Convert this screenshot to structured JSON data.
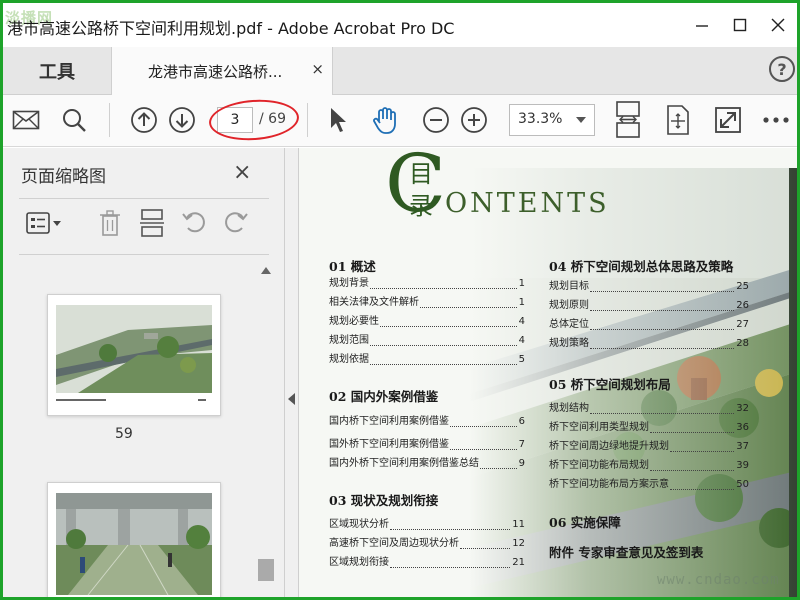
{
  "app": {
    "logo_text": "淡播网",
    "window_title": "港市高速公路桥下空间利用规划.pdf - Adobe Acrobat Pro DC",
    "window_controls": [
      "minimize-icon",
      "maximize-icon",
      "close-icon"
    ],
    "frame_color": "#1ea32a"
  },
  "tabs": {
    "tools_label": "工具",
    "doc_label": "龙港市高速公路桥...",
    "doc_close": "×",
    "help": "?"
  },
  "toolbar": {
    "icons": [
      "mail-icon",
      "search-icon",
      "page-up-icon",
      "page-down-icon",
      "select-arrow-icon",
      "hand-tool-icon",
      "zoom-out-icon",
      "zoom-in-icon",
      "fit-width-icon",
      "fit-page-icon",
      "fullscreen-icon",
      "more-icon"
    ],
    "current_page": "3",
    "total_pages": "/ 69",
    "zoom": "33.3%",
    "highlight_color": "#e0242a"
  },
  "thumbnails_panel": {
    "title": "页面缩略图",
    "close": "×",
    "tool_icons": [
      "options-menu-icon",
      "trash-icon",
      "insert-page-icon",
      "undo-icon",
      "redo-icon"
    ],
    "pages": [
      {
        "number": "59"
      },
      {
        "number": ""
      }
    ]
  },
  "document": {
    "heading_cn_1": "目",
    "heading_cn_2": "录",
    "heading_c": "C",
    "heading_en": "ONTENTS",
    "left_column": [
      {
        "title": "01 概述",
        "items": [
          {
            "label": "规划背景",
            "page": "1"
          },
          {
            "label": "相关法律及文件解析",
            "page": "1"
          },
          {
            "label": "规划必要性",
            "page": "4"
          },
          {
            "label": "规划范围",
            "page": "4"
          },
          {
            "label": "规划依据",
            "page": "5"
          }
        ]
      },
      {
        "title": "02 国内外案例借鉴",
        "items": [
          {
            "label": "国内桥下空间利用案例借鉴",
            "page": "6"
          },
          {
            "label": "国外桥下空间利用案例借鉴",
            "page": "7"
          },
          {
            "label": "国内外桥下空间利用案例借鉴总结",
            "page": "9"
          }
        ]
      },
      {
        "title": "03 现状及规划衔接",
        "items": [
          {
            "label": "区域现状分析",
            "page": "11"
          },
          {
            "label": "高速桥下空间及周边现状分析",
            "page": "12"
          },
          {
            "label": "区域规划衔接",
            "page": "21"
          }
        ]
      }
    ],
    "right_column": [
      {
        "title": "04 桥下空间规划总体思路及策略",
        "items": [
          {
            "label": "规划目标",
            "page": "25"
          },
          {
            "label": "规划原则",
            "page": "26"
          },
          {
            "label": "总体定位",
            "page": "27"
          },
          {
            "label": "规划策略",
            "page": "28"
          }
        ]
      },
      {
        "title": "05 桥下空间规划布局",
        "items": [
          {
            "label": "规划结构",
            "page": "32"
          },
          {
            "label": "桥下空间利用类型规划",
            "page": "36"
          },
          {
            "label": "桥下空间周边绿地提升规划",
            "page": "37"
          },
          {
            "label": "桥下空间功能布局规划",
            "page": "39"
          },
          {
            "label": "桥下空间功能布局方案示意",
            "page": "50"
          }
        ]
      },
      {
        "title": "06 实施保障",
        "items": []
      },
      {
        "title": "附件 专家审查意见及签到表",
        "items": []
      }
    ],
    "watermark": "www.cndao.com"
  }
}
